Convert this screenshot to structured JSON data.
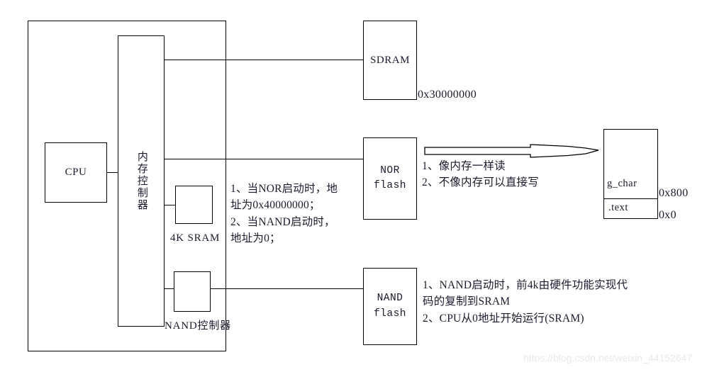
{
  "diagram": {
    "title": "NOR/NAND flash boot memory map diagram",
    "soc": {
      "name": "soc-outer-boundary"
    },
    "blocks": {
      "cpu": "CPU",
      "mem_ctrl": "内存控制器",
      "sram_label": "4K SRAM",
      "nand_ctrl_label": "NAND控制器",
      "sdram": "SDRAM",
      "nor_flash_line1": "NOR",
      "nor_flash_line2": "flash",
      "nand_flash_line1": "NAND",
      "nand_flash_line2": "flash",
      "gchar": "g_char",
      "text_section": ".text"
    },
    "addresses": {
      "sdram": "0x30000000",
      "gchar_top": "0x800",
      "gchar_bottom": "0x0"
    },
    "notes": {
      "boot_addr_line1": "1、当NOR启动时，地",
      "boot_addr_line2": "址为0x40000000；",
      "boot_addr_line3": "2、当NAND启动时，",
      "boot_addr_line4": "地址为0；",
      "nor_note_line1": "1、像内存一样读",
      "nor_note_line2": "2、不像内存可以直接写",
      "nand_note_line1": "1、NAND启动时，前4k由硬件功能实现代",
      "nand_note_line2": "码的复制到SRAM",
      "nand_note_line3": "2、CPU从0地址开始运行(SRAM)"
    },
    "watermark": "https://blog.csdn.net/weixin_44152647",
    "colors": {
      "stroke": "#000000",
      "text": "#1a1a2e",
      "background": "#ffffff",
      "watermark": "#e9e9e9"
    }
  }
}
